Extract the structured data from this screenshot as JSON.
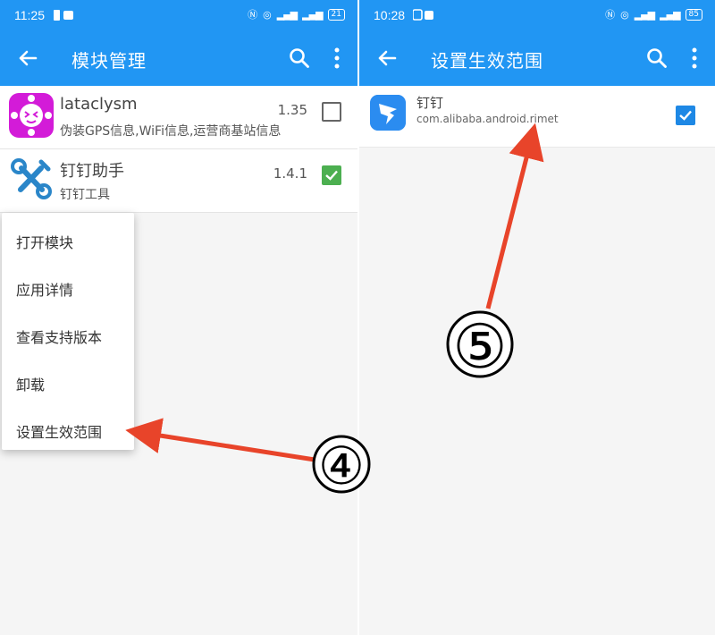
{
  "left": {
    "status": {
      "time": "11:25",
      "battery": "21"
    },
    "appbar": {
      "title": "模块管理"
    },
    "modules": [
      {
        "name": "lataclysm",
        "desc": "伪装GPS信息,WiFi信息,运营商基站信息",
        "version": "1.35",
        "checked": false
      },
      {
        "name": "钉钉助手",
        "desc": "钉钉工具",
        "version": "1.4.1",
        "checked": true
      }
    ],
    "menu": [
      "打开模块",
      "应用详情",
      "查看支持版本",
      "卸载",
      "设置生效范围"
    ],
    "step_marker": "④"
  },
  "right": {
    "status": {
      "time": "10:28",
      "battery": "85"
    },
    "appbar": {
      "title": "设置生效范围"
    },
    "app": {
      "name": "钉钉",
      "package": "com.alibaba.android.rimet",
      "checked": true
    },
    "step_marker": "⑤"
  },
  "colors": {
    "primary": "#2196f3",
    "arrow": "#e8442a",
    "check_green": "#4caf50",
    "check_blue": "#1e88e5"
  }
}
